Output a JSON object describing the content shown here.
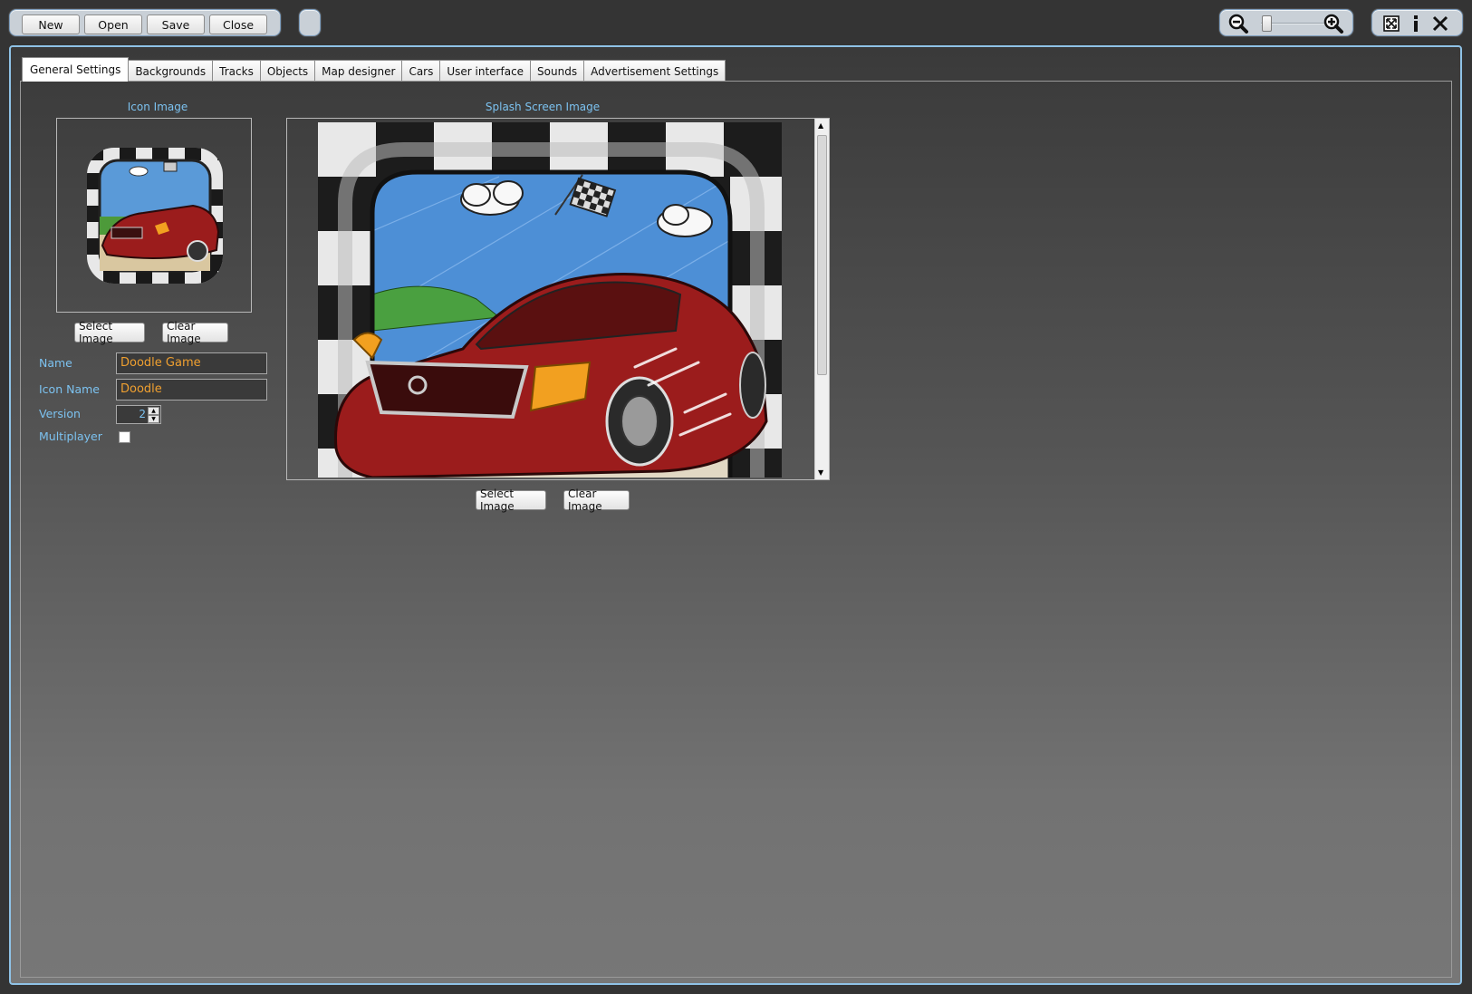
{
  "toolbar": {
    "new_label": "New",
    "open_label": "Open",
    "save_label": "Save",
    "close_label": "Close"
  },
  "tabs": [
    {
      "label": "General Settings",
      "active": true
    },
    {
      "label": "Backgrounds"
    },
    {
      "label": "Tracks"
    },
    {
      "label": "Objects"
    },
    {
      "label": "Map designer"
    },
    {
      "label": "Cars"
    },
    {
      "label": "User interface"
    },
    {
      "label": "Sounds"
    },
    {
      "label": "Advertisement Settings"
    }
  ],
  "general": {
    "icon_image_label": "Icon Image",
    "splash_image_label": "Splash Screen Image",
    "icon_select_label": "Select Image",
    "icon_clear_label": "Clear Image",
    "splash_select_label": "Select Image",
    "splash_clear_label": "Clear Image",
    "name_label": "Name",
    "name_value": "Doodle Game",
    "icon_name_label": "Icon Name",
    "icon_name_value": "Doodle",
    "version_label": "Version",
    "version_value": "2",
    "multiplayer_label": "Multiplayer",
    "multiplayer_checked": false
  },
  "colors": {
    "accent_blue": "#7cc2f0",
    "field_text": "#f0a030",
    "frame_border": "#8fc2e6"
  }
}
